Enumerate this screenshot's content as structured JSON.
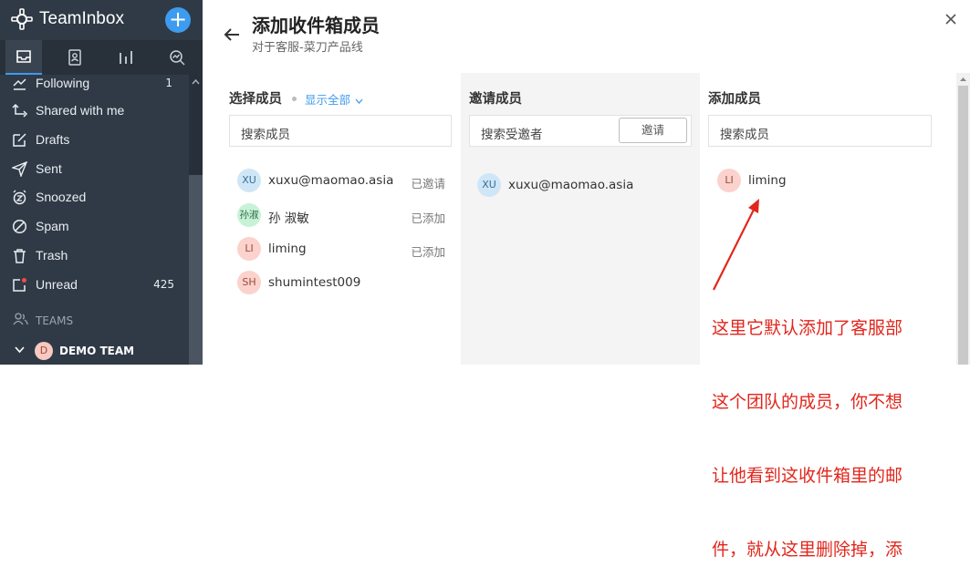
{
  "app": {
    "name": "TeamInbox"
  },
  "iconbar": {
    "icons": [
      "inbox-icon",
      "contacts-icon",
      "reports-icon",
      "analytics-icon"
    ]
  },
  "sidebar": {
    "items": [
      {
        "label": "Following",
        "count": "1",
        "icon": "following-icon"
      },
      {
        "label": "Shared with me",
        "count": "",
        "icon": "shared-icon"
      },
      {
        "label": "Drafts",
        "count": "",
        "icon": "drafts-icon"
      },
      {
        "label": "Sent",
        "count": "",
        "icon": "sent-icon"
      },
      {
        "label": "Snoozed",
        "count": "",
        "icon": "snoozed-icon"
      },
      {
        "label": "Spam",
        "count": "",
        "icon": "spam-icon"
      },
      {
        "label": "Trash",
        "count": "",
        "icon": "trash-icon"
      },
      {
        "label": "Unread",
        "count": "425",
        "icon": "unread-icon"
      }
    ],
    "teams_label": "TEAMS",
    "team": {
      "initial": "D",
      "name": "DEMO TEAM"
    }
  },
  "header": {
    "title": "添加收件箱成员",
    "subtitle": "对于客服-菜刀产品线"
  },
  "select_members": {
    "title": "选择成员",
    "show_all": "显示全部",
    "search_placeholder": "搜索成员",
    "members": [
      {
        "initials": "XU",
        "name": "xuxu@maomao.asia",
        "status": "已邀请",
        "color": "#cfe6f7",
        "text_color": "#3a6f96"
      },
      {
        "initials": "孙淑",
        "name": "孙 淑敏",
        "status": "已添加",
        "color": "#c8f2d8",
        "text_color": "#2d6b45"
      },
      {
        "initials": "LI",
        "name": "liming",
        "status": "已添加",
        "color": "#fbd2cc",
        "text_color": "#9a4a3e"
      },
      {
        "initials": "SH",
        "name": "shumintest009",
        "status": "",
        "color": "#fbd2cc",
        "text_color": "#9a4a3e"
      }
    ]
  },
  "invite_members": {
    "title": "邀请成员",
    "search_placeholder": "搜索受邀者",
    "button": "邀请",
    "members": [
      {
        "initials": "XU",
        "name": "xuxu@maomao.asia",
        "color": "#cfe6f7",
        "text_color": "#3a6f96"
      }
    ]
  },
  "added_members": {
    "title": "添加成员",
    "search_placeholder": "搜索成员",
    "members": [
      {
        "initials": "LI",
        "name": "liming",
        "color": "#fbd2cc",
        "text_color": "#9a4a3e"
      }
    ]
  },
  "annotation": {
    "lines": [
      "这里它默认添加了客服部",
      "这个团队的成员，你不想",
      "让他看到这收件箱里的邮",
      "件，就从这里删除掉，添"
    ]
  }
}
